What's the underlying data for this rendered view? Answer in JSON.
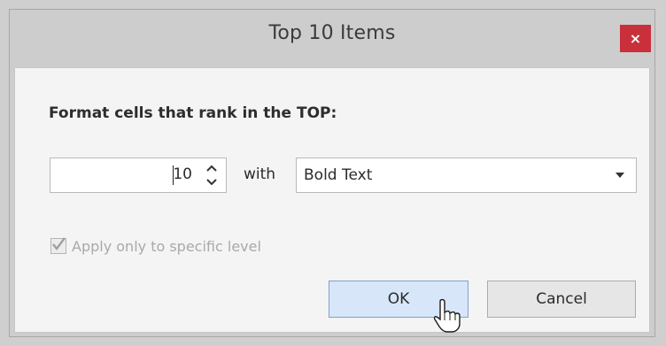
{
  "dialog": {
    "title": "Top 10 Items",
    "close_label": "×",
    "heading": "Format cells that rank in the TOP:",
    "rank_value": "10",
    "with_label": "with",
    "format_selected": "Bold Text",
    "apply_level_label": "Apply only to specific level",
    "apply_level_checked": true,
    "apply_level_enabled": false,
    "ok_label": "OK",
    "cancel_label": "Cancel"
  },
  "icons": {
    "spin_up": "chevron-up-icon",
    "spin_down": "chevron-down-icon",
    "dropdown": "dropdown-arrow-icon",
    "check": "checkmark-icon",
    "cursor": "mouse-pointer-icon"
  },
  "colors": {
    "close_button": "#c9303b",
    "ok_button_bg": "#d7e6f9",
    "ok_button_border": "#7da2ce",
    "disabled_text": "#a9a9a9"
  }
}
